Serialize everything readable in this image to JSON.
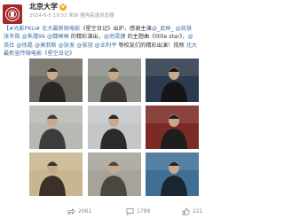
{
  "post": {
    "author": "北京大学",
    "verified_badge": "V",
    "meta": "2014-6-5 19:52 来自 搜狗高速浏览器",
    "text_lines": [
      {
        "segments": [
          {
            "t": "【#光影PKU# 北大最新微电影",
            "link": true
          },
          {
            "t": "《星空日记》出炉，感谢主演",
            "link": false
          },
          {
            "t": "@_武林_",
            "link": true
          },
          {
            "t": " ",
            "link": false
          },
          {
            "t": "@凯慧",
            "link": true
          }
        ]
      },
      {
        "segments": [
          {
            "t": "张冬阳",
            "link": true
          },
          {
            "t": " ",
            "link": false
          },
          {
            "t": "@朱瑾99",
            "link": true
          },
          {
            "t": " ",
            "link": false
          },
          {
            "t": "@魏琳琳",
            "link": true
          },
          {
            "t": " 的精彩演出，",
            "link": false
          },
          {
            "t": "@尚雯婕",
            "link": true
          },
          {
            "t": " 的主题曲《little star》，",
            "link": false
          },
          {
            "t": "@",
            "link": true
          }
        ]
      },
      {
        "segments": [
          {
            "t": "英社",
            "link": true
          },
          {
            "t": " ",
            "link": false
          },
          {
            "t": "@徐磊",
            "link": true
          },
          {
            "t": " ",
            "link": false
          },
          {
            "t": "@莫菲斯",
            "link": true
          },
          {
            "t": " ",
            "link": false
          },
          {
            "t": "@张发",
            "link": true
          },
          {
            "t": " ",
            "link": false
          },
          {
            "t": "@张羽",
            "link": true
          },
          {
            "t": " ",
            "link": false
          },
          {
            "t": "@王利平",
            "link": true
          },
          {
            "t": " 等校友们的精彩出演！视频 ",
            "link": false
          },
          {
            "t": "北大",
            "link": true
          }
        ]
      },
      {
        "segments": [
          {
            "t": "最新宣传微电影《星空日记》",
            "link": true
          }
        ]
      }
    ]
  },
  "images": [
    {
      "name": "photo-man-glasses",
      "bg": "#6f6a63",
      "fg": "#2a2623"
    },
    {
      "name": "photo-young-man",
      "bg": "#8d8f89",
      "fg": "#3a3530"
    },
    {
      "name": "photo-man-stars",
      "bg": "#2b3a4c",
      "fg": "#151515"
    },
    {
      "name": "photo-man-gray",
      "bg": "#b9b9b4",
      "fg": "#3c3c3c"
    },
    {
      "name": "photo-girl-white",
      "bg": "#c4c6c8",
      "fg": "#2a2a2a"
    },
    {
      "name": "photo-man-red-room",
      "bg": "#7c2a25",
      "fg": "#1e1e1e"
    },
    {
      "name": "photo-man-suit",
      "bg": "#c9b58f",
      "fg": "#3a3128"
    },
    {
      "name": "photo-campus-street",
      "bg": "#a7a39a",
      "fg": "#4a4640"
    },
    {
      "name": "photo-figure-night",
      "bg": "#3f6f94",
      "fg": "#1a2530"
    }
  ],
  "actions": {
    "share_count": "2061",
    "comment_count": "1799",
    "like_count": "221"
  },
  "colors": {
    "link": "#3b6ea5",
    "avatar": "#a4282a",
    "badge": "#f5a623"
  }
}
